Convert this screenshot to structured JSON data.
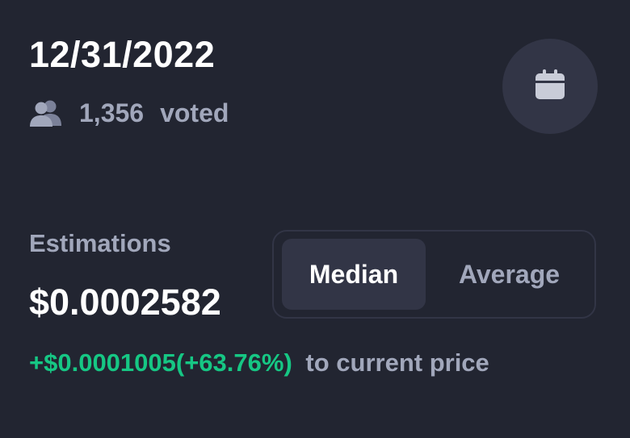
{
  "header": {
    "date": "12/31/2022",
    "vote_count": "1,356",
    "voted_label": "voted",
    "calendar_icon": "calendar-icon",
    "users_icon": "users-icon"
  },
  "estimations": {
    "label": "Estimations",
    "price": "$0.0002582",
    "change": "+$0.0001005(+63.76%)",
    "change_suffix": "to current price"
  },
  "toggle": {
    "options": [
      "Median",
      "Average"
    ],
    "selected": "Median"
  },
  "colors": {
    "background": "#222531",
    "surface": "#323546",
    "muted_text": "#a1a7bb",
    "positive": "#16c784"
  }
}
